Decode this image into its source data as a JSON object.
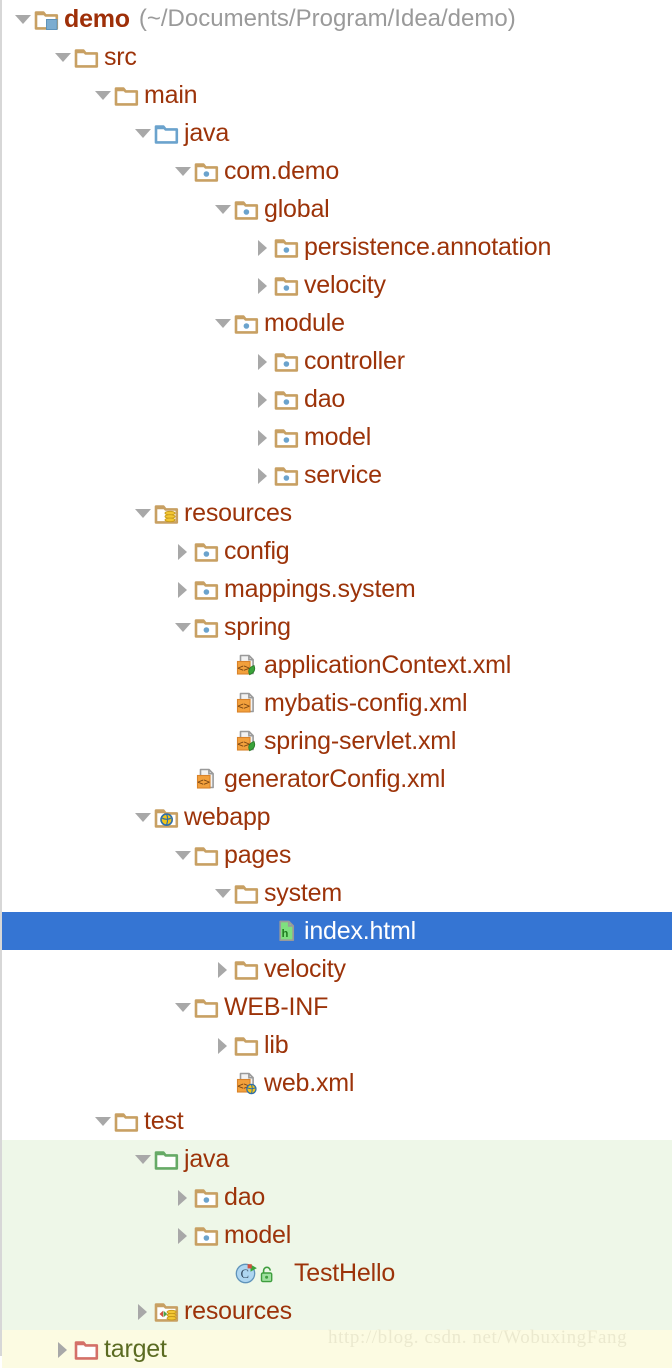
{
  "window": {
    "title": "demo",
    "kind": "project-tree"
  },
  "colors": {
    "text": "#9c3309",
    "path_text": "#9a9a9a",
    "selection_bg": "#3575d3",
    "selection_text": "#ffffff",
    "test_source_bg": "#eef7e8",
    "excluded_bg": "#fcfbe2",
    "folder_tan": "#c8a063",
    "folder_blue": "#6ba3cd",
    "folder_green": "#66aa66",
    "folder_red": "#d47068",
    "arrow": "#a8a8a8",
    "watermark": "#ebe9cf"
  },
  "watermark": "http://blog. csdn. net/WobuxingFang",
  "tree": {
    "rows": [
      {
        "label": "demo",
        "suffix": "(~/Documents/Program/Idea/demo)",
        "depth": 0,
        "arrow": "down",
        "icon": "folder-module-icon",
        "bold": true
      },
      {
        "label": "src",
        "suffix": "",
        "depth": 1,
        "arrow": "down",
        "icon": "folder-icon"
      },
      {
        "label": "main",
        "suffix": "",
        "depth": 2,
        "arrow": "down",
        "icon": "folder-icon"
      },
      {
        "label": "java",
        "suffix": "",
        "depth": 3,
        "arrow": "down",
        "icon": "folder-source-root-icon"
      },
      {
        "label": "com.demo",
        "suffix": "",
        "depth": 4,
        "arrow": "down",
        "icon": "folder-package-icon"
      },
      {
        "label": "global",
        "suffix": "",
        "depth": 5,
        "arrow": "down",
        "icon": "folder-package-icon"
      },
      {
        "label": "persistence.annotation",
        "suffix": "",
        "depth": 6,
        "arrow": "right",
        "icon": "folder-package-icon"
      },
      {
        "label": "velocity",
        "suffix": "",
        "depth": 6,
        "arrow": "right",
        "icon": "folder-package-icon"
      },
      {
        "label": "module",
        "suffix": "",
        "depth": 5,
        "arrow": "down",
        "icon": "folder-package-icon"
      },
      {
        "label": "controller",
        "suffix": "",
        "depth": 6,
        "arrow": "right",
        "icon": "folder-package-icon"
      },
      {
        "label": "dao",
        "suffix": "",
        "depth": 6,
        "arrow": "right",
        "icon": "folder-package-icon"
      },
      {
        "label": "model",
        "suffix": "",
        "depth": 6,
        "arrow": "right",
        "icon": "folder-package-icon"
      },
      {
        "label": "service",
        "suffix": "",
        "depth": 6,
        "arrow": "right",
        "icon": "folder-package-icon"
      },
      {
        "label": "resources",
        "suffix": "",
        "depth": 3,
        "arrow": "down",
        "icon": "folder-resource-root-icon"
      },
      {
        "label": "config",
        "suffix": "",
        "depth": 4,
        "arrow": "right",
        "icon": "folder-package-icon"
      },
      {
        "label": "mappings.system",
        "suffix": "",
        "depth": 4,
        "arrow": "right",
        "icon": "folder-package-icon"
      },
      {
        "label": "spring",
        "suffix": "",
        "depth": 4,
        "arrow": "down",
        "icon": "folder-package-icon"
      },
      {
        "label": "applicationContext.xml",
        "suffix": "",
        "depth": 5,
        "arrow": "none",
        "icon": "xml-spring-file-icon"
      },
      {
        "label": "mybatis-config.xml",
        "suffix": "",
        "depth": 5,
        "arrow": "none",
        "icon": "xml-file-icon"
      },
      {
        "label": "spring-servlet.xml",
        "suffix": "",
        "depth": 5,
        "arrow": "none",
        "icon": "xml-spring-file-icon"
      },
      {
        "label": "generatorConfig.xml",
        "suffix": "",
        "depth": 4,
        "arrow": "none",
        "icon": "xml-file-icon"
      },
      {
        "label": "webapp",
        "suffix": "",
        "depth": 3,
        "arrow": "down",
        "icon": "folder-web-icon"
      },
      {
        "label": "pages",
        "suffix": "",
        "depth": 4,
        "arrow": "down",
        "icon": "folder-icon"
      },
      {
        "label": "system",
        "suffix": "",
        "depth": 5,
        "arrow": "down",
        "icon": "folder-icon"
      },
      {
        "label": "index.html",
        "suffix": "",
        "depth": 6,
        "arrow": "none",
        "icon": "html-file-icon",
        "selected": true
      },
      {
        "label": "velocity",
        "suffix": "",
        "depth": 5,
        "arrow": "right",
        "icon": "folder-icon"
      },
      {
        "label": "WEB-INF",
        "suffix": "",
        "depth": 4,
        "arrow": "down",
        "icon": "folder-icon"
      },
      {
        "label": "lib",
        "suffix": "",
        "depth": 5,
        "arrow": "right",
        "icon": "folder-icon"
      },
      {
        "label": "web.xml",
        "suffix": "",
        "depth": 5,
        "arrow": "none",
        "icon": "xml-web-file-icon"
      },
      {
        "label": "test",
        "suffix": "",
        "depth": 2,
        "arrow": "down",
        "icon": "folder-icon"
      },
      {
        "label": "java",
        "suffix": "",
        "depth": 3,
        "arrow": "down",
        "icon": "folder-test-source-root-icon",
        "region": "test"
      },
      {
        "label": "dao",
        "suffix": "",
        "depth": 4,
        "arrow": "right",
        "icon": "folder-package-icon",
        "region": "test"
      },
      {
        "label": "model",
        "suffix": "",
        "depth": 4,
        "arrow": "right",
        "icon": "folder-package-icon",
        "region": "test"
      },
      {
        "label": "TestHello",
        "suffix": "",
        "depth": 5,
        "arrow": "none",
        "icon": "java-test-class-icon",
        "region": "test"
      },
      {
        "label": "resources",
        "suffix": "",
        "depth": 3,
        "arrow": "right",
        "icon": "folder-test-resource-root-icon",
        "region": "test"
      },
      {
        "label": "target",
        "suffix": "",
        "depth": 1,
        "arrow": "right",
        "icon": "folder-excluded-icon",
        "region": "excluded"
      }
    ]
  }
}
